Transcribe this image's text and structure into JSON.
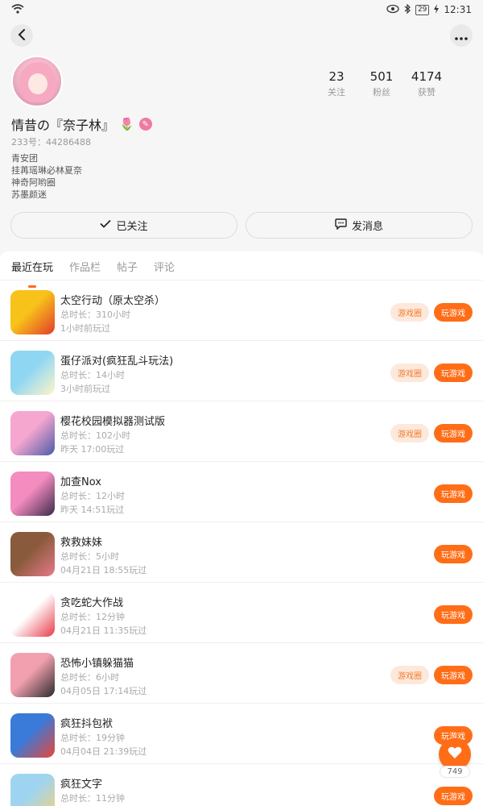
{
  "status_bar": {
    "time": "12:31",
    "battery": "29",
    "icons": [
      "wifi-icon",
      "eye-icon",
      "bluetooth-icon",
      "battery-icon",
      "charging-icon"
    ]
  },
  "profile": {
    "nickname": "情昔の『奈子林』",
    "uid": "233号：44286488",
    "bio": [
      "青安团",
      "挂苒瑶琳必林夏奈",
      "神奇阿哟圈",
      "苏墨颜迷"
    ],
    "stats": [
      {
        "value": "23",
        "label": "关注"
      },
      {
        "value": "501",
        "label": "粉丝"
      },
      {
        "value": "4174",
        "label": "获赞"
      }
    ],
    "follow_label": "已关注",
    "message_label": "发消息"
  },
  "tabs": [
    "最近在玩",
    "作品栏",
    "帖子",
    "评论"
  ],
  "games": [
    {
      "name": "太空行动（原太空杀）",
      "duration": "总时长：310小时",
      "last_played": "1小时前玩过",
      "has_circle": true,
      "icon_colors": [
        "#f7c21a",
        "#e23a2c"
      ]
    },
    {
      "name": "蛋仔派对(疯狂乱斗玩法)",
      "duration": "总时长：14小时",
      "last_played": "3小时前玩过",
      "has_circle": true,
      "icon_colors": [
        "#8fd6f3",
        "#fff6c8"
      ]
    },
    {
      "name": "樱花校园模拟器测试版",
      "duration": "总时长：102小时",
      "last_played": "昨天 17:00玩过",
      "has_circle": true,
      "icon_colors": [
        "#f6a7cf",
        "#4b5aa8"
      ]
    },
    {
      "name": "加查Nox",
      "duration": "总时长：12小时",
      "last_played": "昨天 14:51玩过",
      "has_circle": false,
      "icon_colors": [
        "#f58cc0",
        "#3a2a4a"
      ]
    },
    {
      "name": "救救妹妹",
      "duration": "总时长：5小时",
      "last_played": "04月21日 18:55玩过",
      "has_circle": false,
      "icon_colors": [
        "#8a5a3c",
        "#e77a8a"
      ]
    },
    {
      "name": "贪吃蛇大作战",
      "duration": "总时长：12分钟",
      "last_played": "04月21日 11:35玩过",
      "has_circle": false,
      "icon_colors": [
        "#ffffff",
        "#e83a4a"
      ]
    },
    {
      "name": "恐怖小镇躲猫猫",
      "duration": "总时长：6小时",
      "last_played": "04月05日 17:14玩过",
      "has_circle": true,
      "icon_colors": [
        "#f2a0b0",
        "#2a2a2a"
      ]
    },
    {
      "name": "疯狂抖包袱",
      "duration": "总时长：19分钟",
      "last_played": "04月04日 21:39玩过",
      "has_circle": false,
      "icon_colors": [
        "#3a7ad8",
        "#e8463a"
      ]
    },
    {
      "name": "疯狂文字",
      "duration": "总时长：11分钟",
      "last_played": "",
      "has_circle": false,
      "icon_colors": [
        "#9fd4f0",
        "#f3d27a"
      ]
    }
  ],
  "circle_label": "游戏圈",
  "play_label": "玩游戏",
  "like_count": "749"
}
